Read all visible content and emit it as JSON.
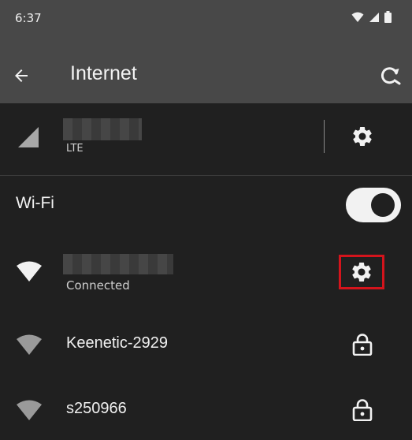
{
  "status_bar": {
    "time": "6:37"
  },
  "toolbar": {
    "title": "Internet"
  },
  "mobile": {
    "network_type": "LTE"
  },
  "wifi": {
    "label": "Wi-Fi",
    "enabled": true
  },
  "networks": [
    {
      "name": "",
      "status": "Connected",
      "secured": false,
      "connected": true
    },
    {
      "name": "Keenetic-2929",
      "secured": true
    },
    {
      "name": "s250966",
      "secured": true
    }
  ],
  "colors": {
    "header_bg": "#484848",
    "page_bg": "#202020",
    "highlight_box": "#d4141c"
  }
}
